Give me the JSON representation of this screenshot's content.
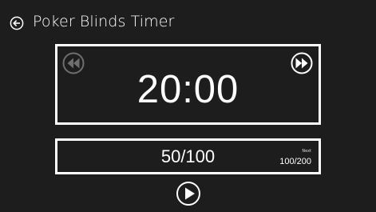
{
  "header": {
    "back_icon": "back-arrow-circle-icon",
    "title": "Poker Blinds Timer"
  },
  "timer": {
    "time": "20:00",
    "rewind_icon": "rewind-circle-icon",
    "rewind_enabled": false,
    "forward_icon": "fast-forward-circle-icon",
    "forward_enabled": true
  },
  "blinds": {
    "current": "50/100",
    "next_label": "Next",
    "next_value": "100/200"
  },
  "controls": {
    "play_icon": "play-circle-icon"
  },
  "colors": {
    "background": "#1d1d1d",
    "foreground": "#ffffff",
    "disabled": "#6e6e6e"
  }
}
